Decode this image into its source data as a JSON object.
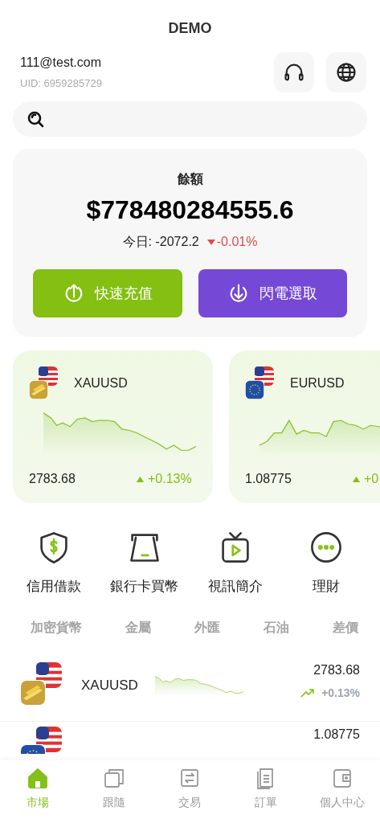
{
  "header": {
    "title": "DEMO"
  },
  "account": {
    "email": "111@test.com",
    "uid": "UID: 6959285729"
  },
  "balance": {
    "label": "餘額",
    "amount": "$778480284555.6",
    "today": "今日: -2072.2",
    "change": "-0.01%"
  },
  "actions": [
    {
      "kind": "deposit",
      "label": "快速充值"
    },
    {
      "kind": "withdraw",
      "label": "閃電選取"
    }
  ],
  "markets": [
    {
      "kind": "gold",
      "symbol": "XAUUSD",
      "price": "2783.68",
      "change": "+0.13%"
    },
    {
      "kind": "eu",
      "symbol": "EURUSD",
      "price": "1.08775",
      "change": "+0"
    }
  ],
  "shortcuts": [
    {
      "kind": "shield",
      "label": "信用借款"
    },
    {
      "kind": "atm",
      "label": "銀行卡買幣"
    },
    {
      "kind": "tv",
      "label": "視訊簡介"
    },
    {
      "kind": "more",
      "label": "理財"
    }
  ],
  "categories": [
    {
      "label": "加密貨幣",
      "selected": false
    },
    {
      "label": "金屬",
      "selected": false
    },
    {
      "label": "外匯",
      "selected": false
    },
    {
      "label": "石油",
      "selected": false
    },
    {
      "label": "差價",
      "selected": false
    }
  ],
  "rows": [
    {
      "kind": "gold",
      "symbol": "XAUUSD",
      "price": "2783.68",
      "change": "+0.13%"
    },
    {
      "kind": "eu",
      "price": "1.08775"
    }
  ],
  "nav": [
    {
      "kind": "home",
      "label": "市場",
      "selected": true
    },
    {
      "kind": "copy",
      "label": "跟隨",
      "selected": false
    },
    {
      "kind": "swap",
      "label": "交易",
      "selected": false
    },
    {
      "kind": "doc",
      "label": "訂單",
      "selected": false
    },
    {
      "kind": "wallet",
      "label": "個人中心",
      "selected": false
    }
  ]
}
